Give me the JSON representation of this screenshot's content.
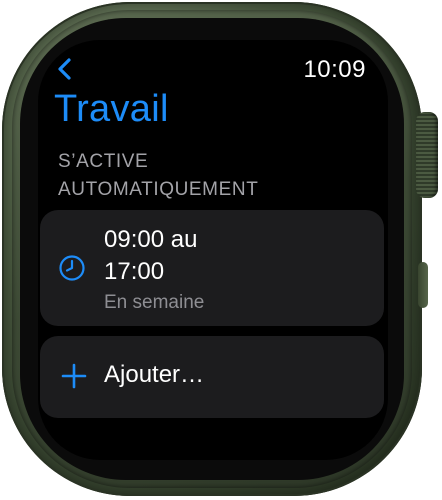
{
  "status_bar": {
    "time": "10:09"
  },
  "header": {
    "title": "Travail"
  },
  "section": {
    "header_line1": "S’ACTIVE",
    "header_line2": "AUTOMATIQUEMENT"
  },
  "schedule": {
    "time_line1": "09:00 au",
    "time_line2": "17:00",
    "days": "En semaine",
    "icon": "clock-icon"
  },
  "add": {
    "label": "Ajouter…",
    "icon": "plus-icon"
  },
  "colors": {
    "accent": "#1d8cf8",
    "card": "#1c1c1e",
    "secondary_text": "#8e8e93",
    "case": "#4a5a40"
  }
}
